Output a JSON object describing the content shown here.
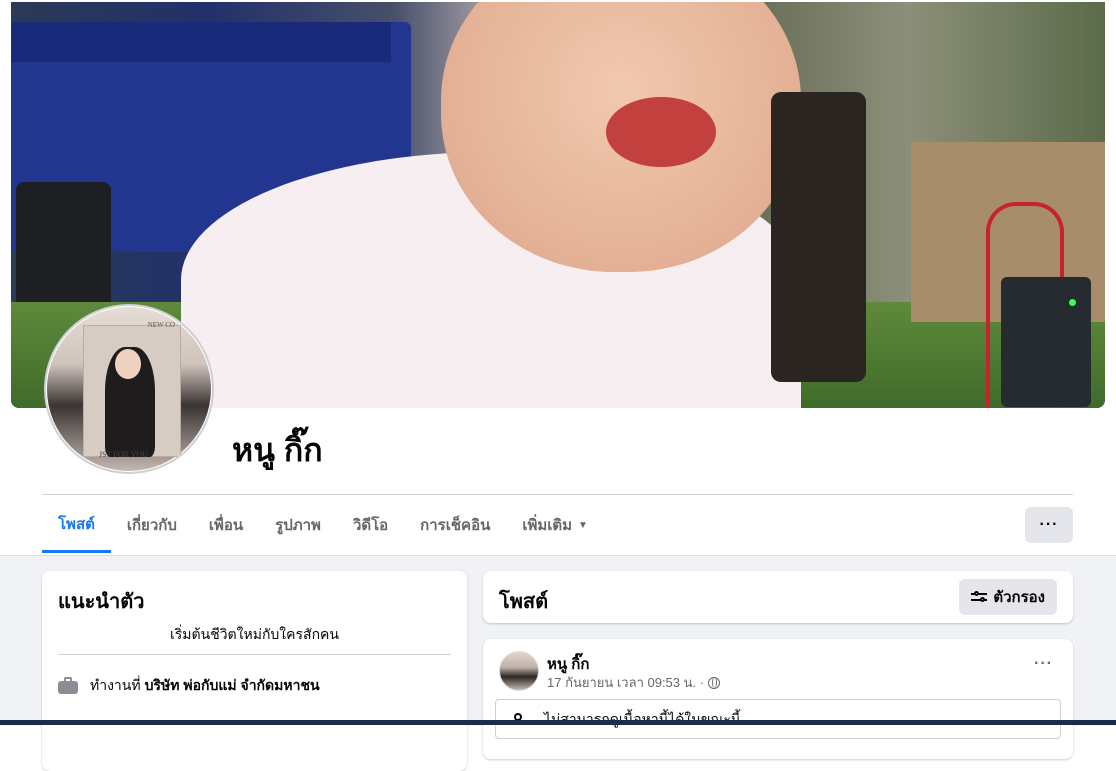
{
  "profile": {
    "name": "หนู กิ๊ก"
  },
  "tabs": [
    {
      "label": "โพสต์",
      "active": true
    },
    {
      "label": "เกี่ยวกับ",
      "active": false
    },
    {
      "label": "เพื่อน",
      "active": false
    },
    {
      "label": "รูปภาพ",
      "active": false
    },
    {
      "label": "วิดีโอ",
      "active": false
    },
    {
      "label": "การเช็คอิน",
      "active": false
    },
    {
      "label": "เพิ่มเติม",
      "active": false,
      "has_dropdown": true
    }
  ],
  "more_button_label": "···",
  "intro": {
    "title": "แนะนำตัว",
    "bio": "เริ่มต้นชีวิตใหม่กับใครสักคน",
    "work_prefix": "ทำงานที่",
    "work_company": "บริษัท พ่อกับแม่ จำกัดมหาชน",
    "work_icon": "briefcase-icon"
  },
  "posts": {
    "title": "โพสต์",
    "filter_label": "ตัวกรอง",
    "filter_icon": "sliders-icon"
  },
  "post": {
    "author": "หนู กิ๊ก",
    "timestamp": "17 กันยายน เวลา 09:53 น. ·",
    "privacy_icon": "globe-icon",
    "options_label": "···",
    "notice": "ไม่สามารถดูเนื้อหานี้ได้ในขณะนี้"
  },
  "avatar_caption_top": "NEW CO",
  "avatar_caption_bottom": "JST FOR YOU",
  "colors": {
    "accent": "#1877f2",
    "page_bg": "#f0f2f5",
    "secondary_text": "#65676b",
    "button_bg": "#e4e6eb"
  }
}
